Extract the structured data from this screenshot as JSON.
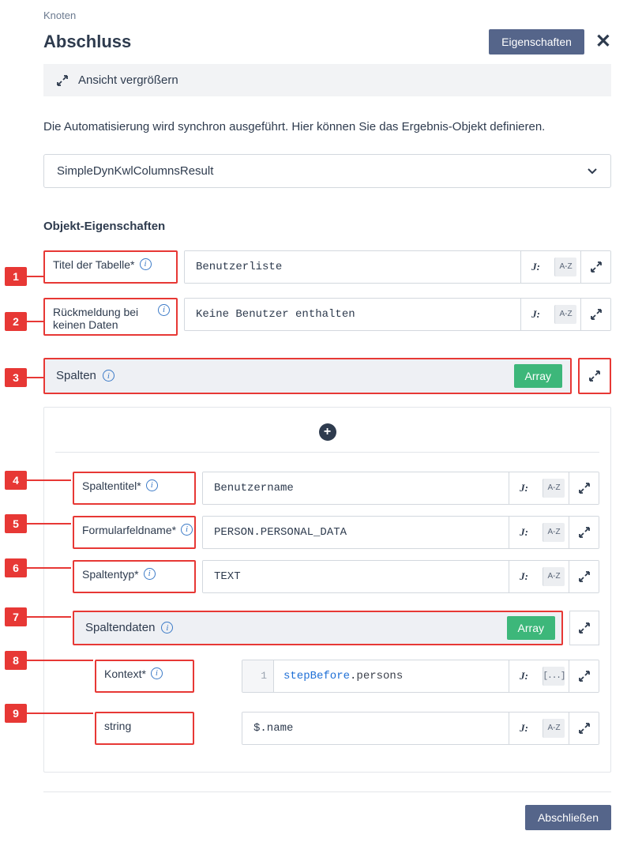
{
  "breadcrumb": "Knoten",
  "title": "Abschluss",
  "header": {
    "props_btn": "Eigenschaften"
  },
  "expand_bar": "Ansicht vergrößern",
  "description": "Die Automatisierung wird synchron ausgeführt. Hier können Sie das Ergebnis-Objekt definieren.",
  "select_value": "SimpleDynKwlColumnsResult",
  "section": "Objekt-Eigenschaften",
  "badges": {
    "array": "Array",
    "j": "J:",
    "az": "A-Z",
    "brackets": "[...]"
  },
  "labels": {
    "title_table": "Titel der Tabelle*",
    "no_data": "Rückmeldung bei keinen Daten",
    "columns": "Spalten",
    "col_title": "Spaltentitel*",
    "form_field": "Formularfeldname*",
    "col_type": "Spaltentyp*",
    "col_data": "Spaltendaten",
    "context": "Kontext*",
    "string": "string"
  },
  "values": {
    "title_table": "Benutzerliste",
    "no_data": "Keine Benutzer enthalten",
    "col_title": "Benutzername",
    "form_field": "PERSON.PERSONAL_DATA",
    "col_type": "TEXT",
    "context_a": "stepBefore",
    "context_b": ".persons",
    "string": "$.name"
  },
  "footer": {
    "close": "Abschließen"
  },
  "nums": [
    "1",
    "2",
    "3",
    "4",
    "5",
    "6",
    "7",
    "8",
    "9"
  ]
}
